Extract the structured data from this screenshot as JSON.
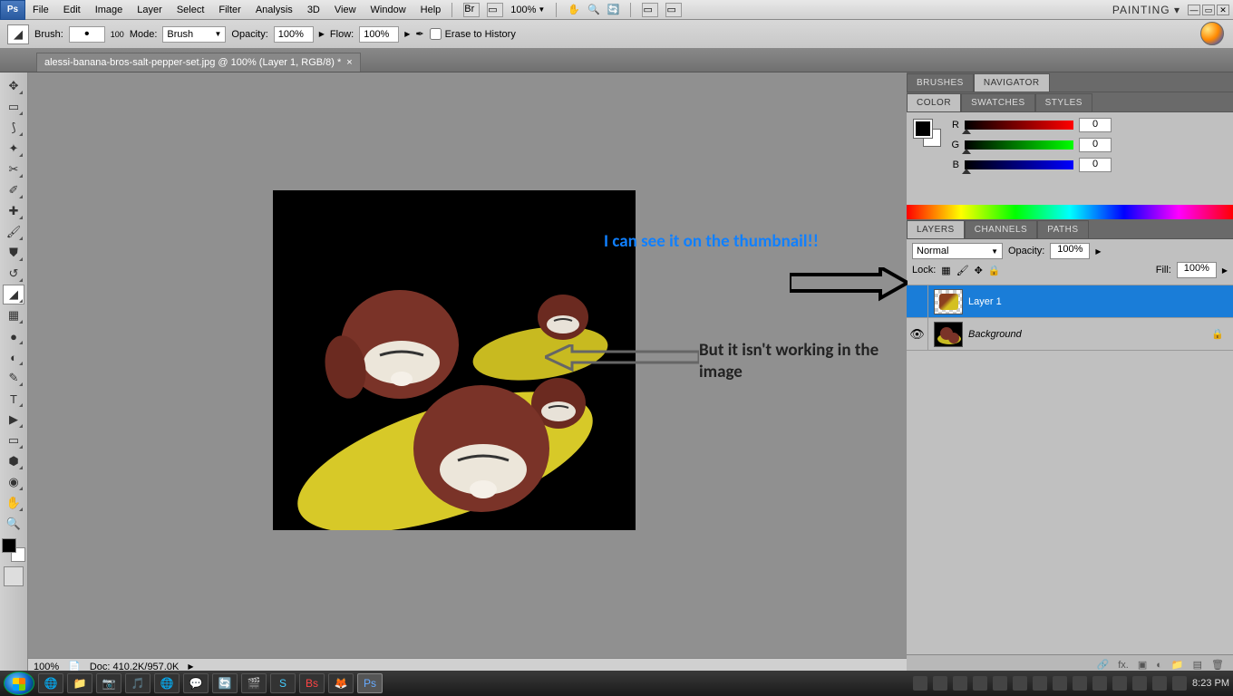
{
  "menubar": {
    "items": [
      "File",
      "Edit",
      "Image",
      "Layer",
      "Select",
      "Filter",
      "Analysis",
      "3D",
      "View",
      "Window",
      "Help"
    ],
    "zoom": "100%",
    "workspace": "PAINTING ▾"
  },
  "options": {
    "brush_label": "Brush:",
    "brush_size": "100",
    "mode_label": "Mode:",
    "mode_value": "Brush",
    "opacity_label": "Opacity:",
    "opacity_value": "100%",
    "flow_label": "Flow:",
    "flow_value": "100%",
    "erase_label": "Erase to History"
  },
  "doc": {
    "tab_title": "alessi-banana-bros-salt-pepper-set.jpg @ 100% (Layer 1, RGB/8) *",
    "status_zoom": "100%",
    "status_doc": "Doc: 410.2K/957.0K"
  },
  "panels": {
    "top_tabs": [
      "BRUSHES",
      "NAVIGATOR"
    ],
    "color_tabs": [
      "COLOR",
      "SWATCHES",
      "STYLES"
    ],
    "layers_tabs": [
      "LAYERS",
      "CHANNELS",
      "PATHS"
    ]
  },
  "color": {
    "r_label": "R",
    "r_value": "0",
    "g_label": "G",
    "g_value": "0",
    "b_label": "B",
    "b_value": "0"
  },
  "layers": {
    "blend_mode": "Normal",
    "opacity_label": "Opacity:",
    "opacity_value": "100%",
    "lock_label": "Lock:",
    "fill_label": "Fill:",
    "fill_value": "100%",
    "items": [
      {
        "name": "Layer 1",
        "visible": false,
        "selected": true,
        "locked": false
      },
      {
        "name": "Background",
        "visible": true,
        "selected": false,
        "locked": true
      }
    ]
  },
  "annotations": {
    "a1": "I can see it on the thumbnail!!",
    "a2": "But it isn't working in the image"
  },
  "taskbar": {
    "time": "8:23 PM"
  }
}
